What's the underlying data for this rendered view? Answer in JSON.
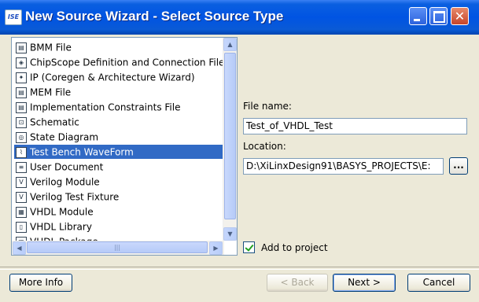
{
  "window": {
    "icon_text": "ISE",
    "title": "New Source Wizard - Select Source Type"
  },
  "source_types": [
    {
      "label": "BMM File",
      "icon": "file-icon"
    },
    {
      "label": "ChipScope Definition and Connection File",
      "icon": "chipscope-icon"
    },
    {
      "label": "IP (Coregen & Architecture Wizard)",
      "icon": "ip-icon"
    },
    {
      "label": "MEM File",
      "icon": "file-icon"
    },
    {
      "label": "Implementation Constraints File",
      "icon": "file-icon"
    },
    {
      "label": "Schematic",
      "icon": "schematic-icon"
    },
    {
      "label": "State Diagram",
      "icon": "state-diagram-icon"
    },
    {
      "label": "Test Bench WaveForm",
      "icon": "waveform-icon",
      "selected": true
    },
    {
      "label": "User Document",
      "icon": "document-icon"
    },
    {
      "label": "Verilog Module",
      "icon": "verilog-icon"
    },
    {
      "label": "Verilog Test Fixture",
      "icon": "verilog-icon"
    },
    {
      "label": "VHDL Module",
      "icon": "vhdl-icon"
    },
    {
      "label": "VHDL Library",
      "icon": "library-icon"
    },
    {
      "label": "VHDL Package",
      "icon": "vhdl-icon"
    }
  ],
  "form": {
    "file_name_label": "File name:",
    "file_name_value": "Test_of_VHDL_Test",
    "location_label": "Location:",
    "location_value": "D:\\XiLinxDesign91\\BASYS_PROJECTS\\E:",
    "browse_label": "...",
    "add_to_project_label": "Add to project",
    "add_to_project_checked": true
  },
  "buttons": {
    "more_info": "More Info",
    "back": "< Back",
    "next": "Next >",
    "cancel": "Cancel"
  }
}
